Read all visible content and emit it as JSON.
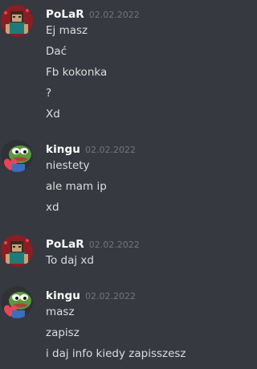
{
  "messages": [
    {
      "author": "PoLaR",
      "timestamp": "02.02.2022",
      "avatar": "minecraft-character-avatar",
      "lines": [
        "Ej masz",
        "Dać",
        "Fb kokonka",
        "?",
        "Xd"
      ]
    },
    {
      "author": "kingu",
      "timestamp": "02.02.2022",
      "avatar": "pepe-frog-heart-avatar",
      "lines": [
        "niestety",
        "ale mam ip",
        "xd"
      ]
    },
    {
      "author": "PoLaR",
      "timestamp": "02.02.2022",
      "avatar": "minecraft-character-avatar",
      "lines": [
        "To daj xd"
      ]
    },
    {
      "author": "kingu",
      "timestamp": "02.02.2022",
      "avatar": "pepe-frog-heart-avatar",
      "lines": [
        "masz",
        "zapisz",
        "i daj info kiedy zapisszesz"
      ]
    }
  ],
  "colors": {
    "background": "#36393f",
    "author": "#ffffff",
    "timestamp": "#72767d",
    "message_text": "#dcddde"
  }
}
